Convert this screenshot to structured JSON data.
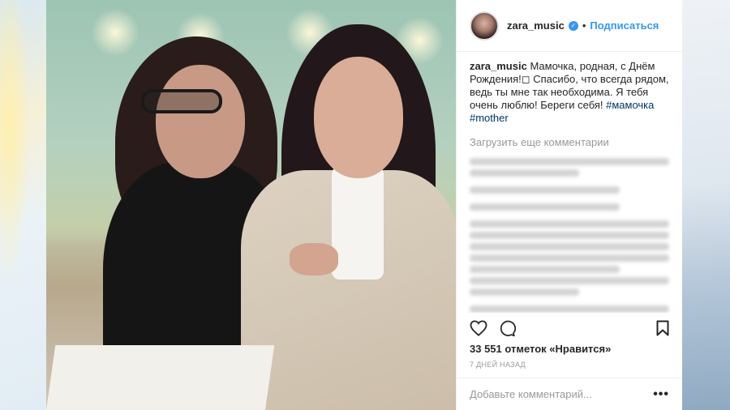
{
  "post": {
    "username": "zara_music",
    "follow_label": "Подписаться",
    "separator": "•",
    "verified_icon": "verified-badge-icon",
    "caption_text": " Мамочка, родная, с Днём Рождения!◻ Спасибо, что всегда рядом, ведь ты мне так необходима. Я тебя очень люблю! Береги себя! ",
    "hashtags": [
      "#мамочка",
      "#mother"
    ],
    "load_more_label": "Загрузить еще комментарии",
    "likes_text": "33 551 отметок «Нравится»",
    "time_text": "7 ДНЕЙ НАЗАД",
    "comment_placeholder": "Добавьте комментарий...",
    "more_label": "•••",
    "accent_color": "#3897f0",
    "hashtag_color": "#003569"
  }
}
